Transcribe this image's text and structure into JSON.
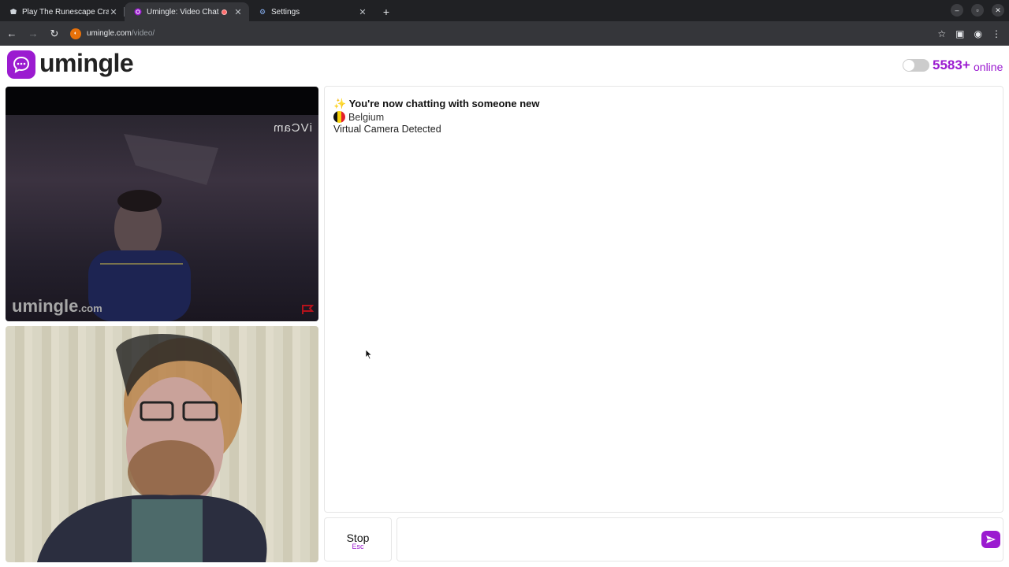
{
  "browser": {
    "tabs": [
      {
        "title": "Play The Runescape Cra",
        "icon": "runescape-icon"
      },
      {
        "title": "Umingle: Video Chat",
        "icon": "umingle-icon",
        "recording": true
      },
      {
        "title": "Settings",
        "icon": "gear-icon"
      }
    ],
    "url_domain": "umingle.com",
    "url_path": "/video/"
  },
  "header": {
    "logo_text": "umingle",
    "online_count": "5583+",
    "online_label": "online"
  },
  "remote_video": {
    "overlay_text": "iVCam",
    "watermark_main": "umingle",
    "watermark_suffix": ".com"
  },
  "chat": {
    "line1": "✨ You're now chatting with someone new",
    "country": "Belgium",
    "line3": "Virtual Camera Detected"
  },
  "controls": {
    "stop_label": "Stop",
    "stop_hint": "Esc",
    "input_placeholder": ""
  },
  "colors": {
    "brand": "#9b1bd0",
    "chrome_dark": "#202124"
  }
}
